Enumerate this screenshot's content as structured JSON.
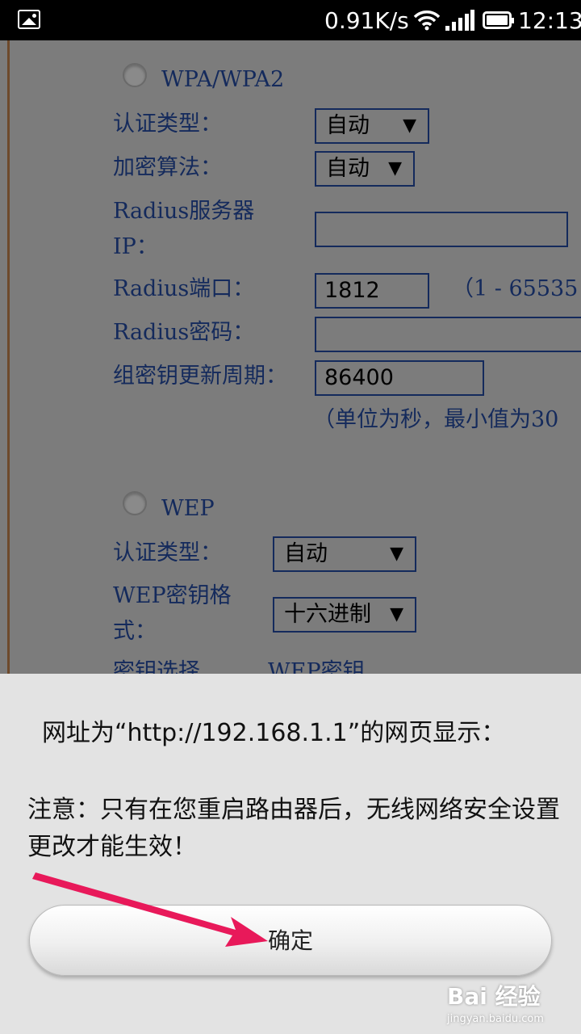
{
  "status_bar": {
    "network_speed": "0.91K/s",
    "time": "12:13",
    "icons": [
      "image-icon",
      "wifi-icon",
      "signal-icon",
      "battery-icon"
    ]
  },
  "router_page": {
    "wpa": {
      "radio_label": "WPA/WPA2",
      "auth_type_label": "认证类型：",
      "auth_type_value": "自动",
      "encryption_label": "加密算法：",
      "encryption_value": "自动",
      "radius_server_label_line1": "Radius服务器",
      "radius_server_label_line2": "IP：",
      "radius_server_value": "",
      "radius_port_label": "Radius端口：",
      "radius_port_value": "1812",
      "radius_port_range": "（1 - 65535",
      "radius_password_label": "Radius密码：",
      "radius_password_value": "",
      "group_key_label": "组密钥更新周期：",
      "group_key_value": "86400",
      "group_key_hint": "（单位为秒，最小值为30"
    },
    "wep": {
      "radio_label": "WEP",
      "auth_type_label": "认证类型：",
      "auth_type_value": "自动",
      "key_format_label_line1": "WEP密钥格",
      "key_format_label_line2": "式：",
      "key_format_value": "十六进制",
      "key_select_label": "密钥选择",
      "wep_key_label": "WEP密钥"
    }
  },
  "dialog": {
    "title": "网址为“http://192.168.1.1”的网页显示：",
    "message": "注意：只有在您重启路由器后，无线网络安全设置更改才能生效！",
    "confirm_label": "确定"
  },
  "annotation": {
    "arrow_color": "#e8195a"
  },
  "watermark": {
    "brand": "Bai 经验",
    "url": "jingyan.baidu.com"
  }
}
